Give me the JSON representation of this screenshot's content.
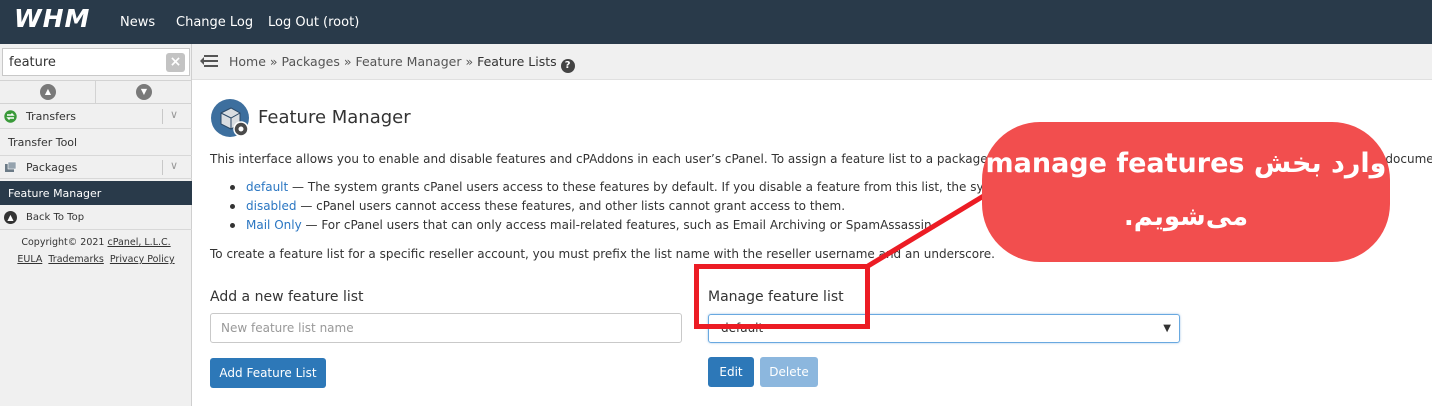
{
  "topbar": {
    "logo": "WHM",
    "nav": [
      "News",
      "Change Log",
      "Log Out (root)"
    ]
  },
  "sidebar": {
    "search_value": "feature",
    "categories": [
      {
        "label": "Transfers",
        "icon": "transfer-icon",
        "items": [
          "Transfer Tool"
        ]
      },
      {
        "label": "Packages",
        "icon": "packages-icon",
        "items": [
          "Feature Manager"
        ]
      }
    ],
    "back_to_top": "Back To Top",
    "footer": {
      "copyright_prefix": "Copyright© 2021 ",
      "company": "cPanel, L.L.C.",
      "links": [
        "EULA",
        "Trademarks",
        "Privacy Policy"
      ]
    }
  },
  "breadcrumb": {
    "items": [
      "Home",
      "Packages",
      "Feature Manager"
    ],
    "separator": " » ",
    "current": "Feature Lists"
  },
  "main": {
    "title": "Feature Manager",
    "intro": "This interface allows you to enable and disable features and cPAddons in each user’s cPanel. To assign a feature list to a package, use the Edit a Package interface. For more information, read the documentation.",
    "bullets": [
      {
        "term": "default",
        "text": " — The system grants cPanel users access to these features by default. If you disable a feature from this list, the system will disable it in every user’s cPanel that uses that list."
      },
      {
        "term": "disabled",
        "text": " — cPanel users cannot access these features, and other lists cannot grant access to them."
      },
      {
        "term": "Mail Only",
        "text": " — For cPanel users that can only access mail-related features, such as Email Archiving or SpamAssassin."
      }
    ],
    "prefix_note": "To create a feature list for a specific reseller account, you must prefix the list name with the reseller username and an underscore.",
    "add": {
      "title": "Add a new feature list",
      "placeholder": "New feature list name",
      "button": "Add Feature List"
    },
    "manage": {
      "title": "Manage feature list",
      "selected": "default",
      "edit_button": "Edit",
      "delete_button": "Delete"
    }
  },
  "annotation": {
    "line1": "وارد بخش manage features",
    "line2": "می‌شویم."
  },
  "colors": {
    "topbar": "#293a4a",
    "link": "#2a76c2",
    "primary_button": "#2d78b8",
    "annotation": "#f24e4e"
  }
}
